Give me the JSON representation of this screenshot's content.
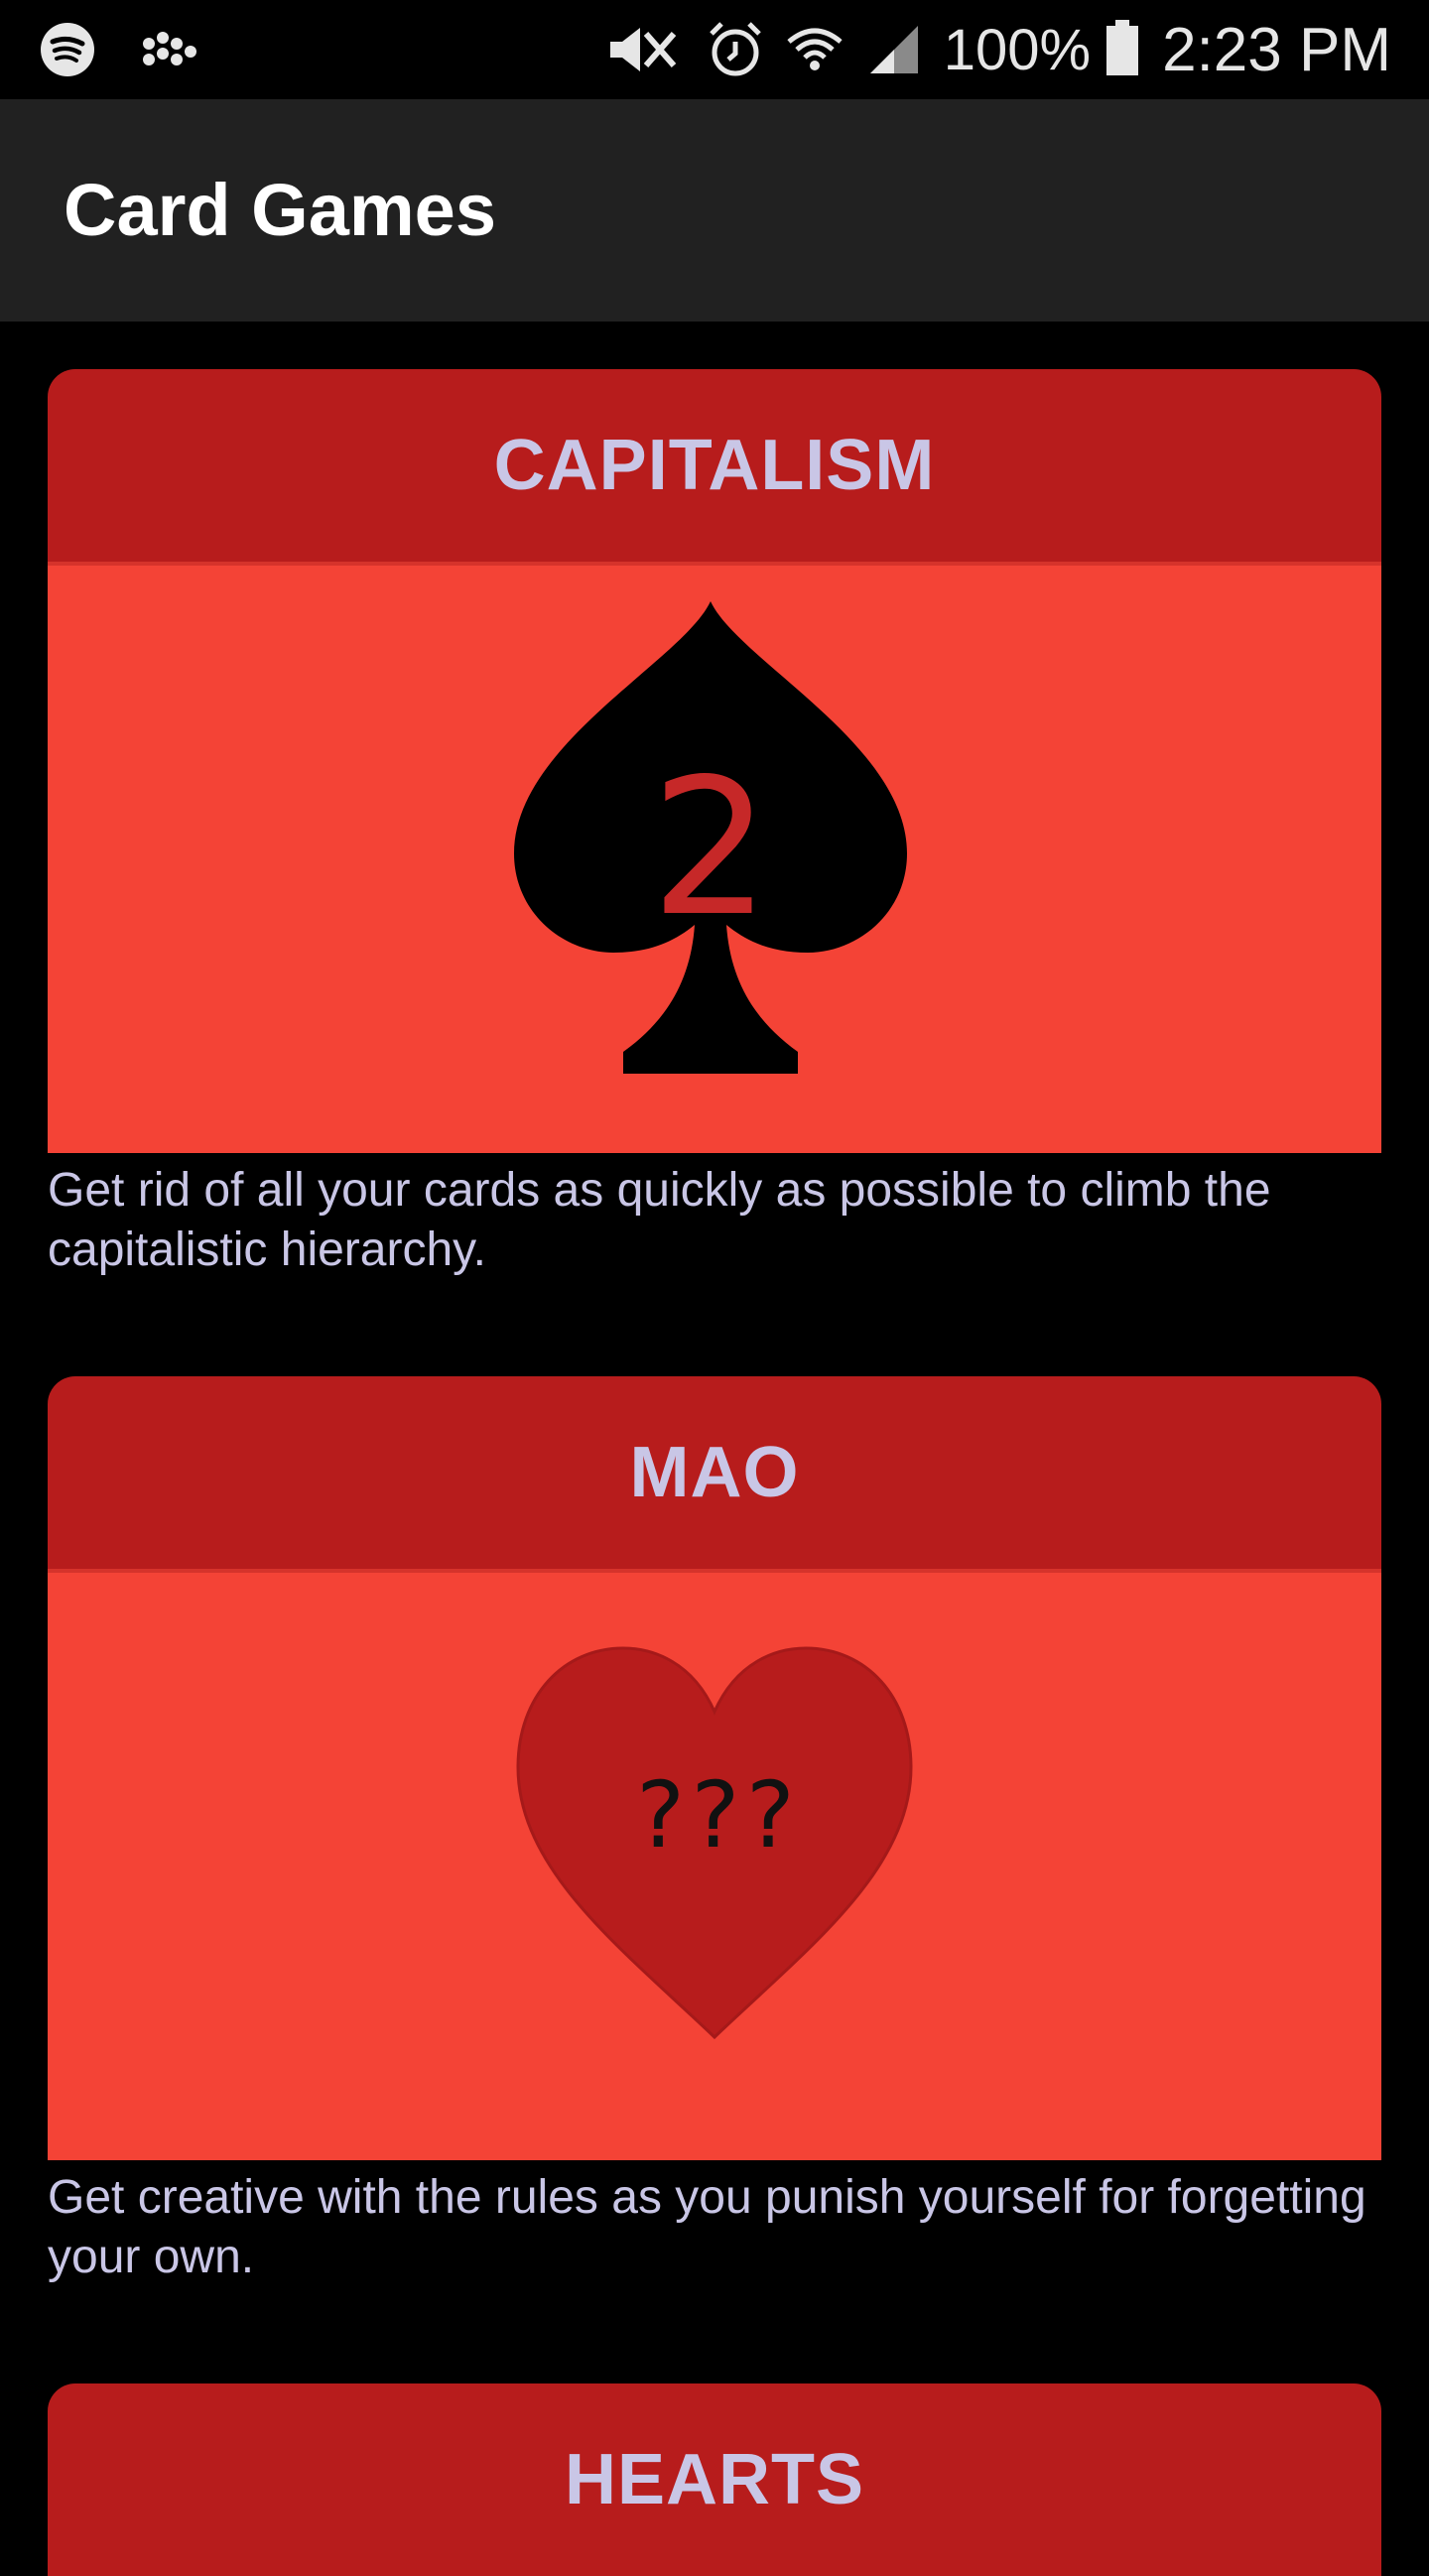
{
  "status_bar": {
    "battery_percent": "100%",
    "time": "2:23 PM",
    "icons": [
      "spotify-icon",
      "dots-app-icon",
      "mute-icon",
      "alarm-icon",
      "wifi-icon",
      "signal-icon",
      "battery-icon"
    ]
  },
  "app_bar": {
    "title": "Card Games"
  },
  "games": [
    {
      "title": "CAPITALISM",
      "image_icon": "spade-icon",
      "image_text": "2",
      "description": "Get rid of all your cards as quickly as possible to climb the capitalistic hierarchy."
    },
    {
      "title": "MAO",
      "image_icon": "heart-icon",
      "image_text": "???",
      "description": "Get creative with the rules as you punish yourself for forgetting your own."
    },
    {
      "title": "HEARTS"
    }
  ],
  "colors": {
    "background": "#000000",
    "app_bar": "#212121",
    "card_header": "#b71c1c",
    "card_image_bg": "#f44336",
    "title_text": "#c9c6e6",
    "spade": "#000000",
    "heart": "#b71c1c"
  }
}
